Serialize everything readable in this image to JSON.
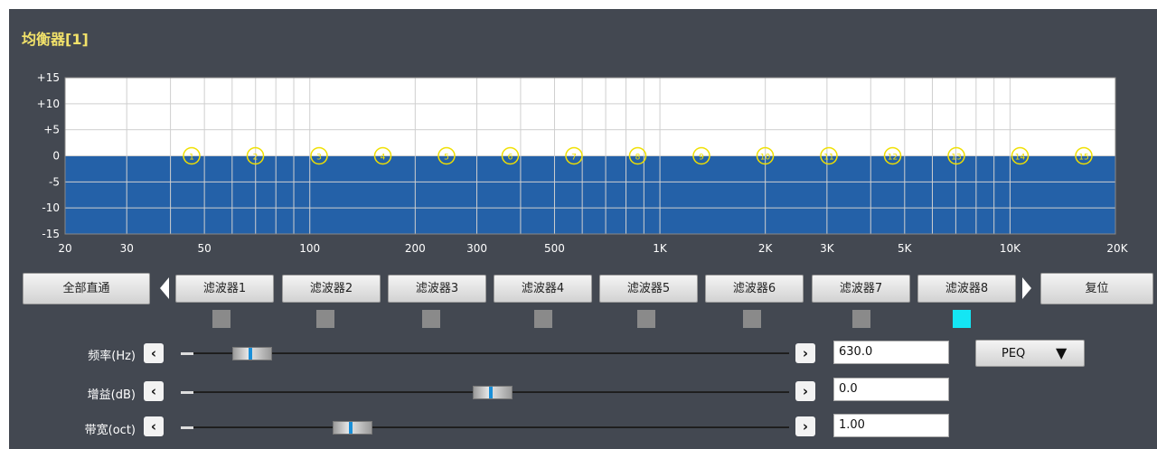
{
  "title": "均衡器[1]",
  "graph": {
    "y_tick_labels": [
      "+15",
      "+10",
      "+5",
      "0",
      "-5",
      "-10",
      "-15"
    ],
    "x_tick_labels": [
      "20",
      "30",
      "50",
      "100",
      "200",
      "300",
      "500",
      "1K",
      "2K",
      "3K",
      "5K",
      "10K",
      "20K"
    ],
    "band_markers": [
      "1",
      "2",
      "3",
      "4",
      "5",
      "6",
      "7",
      "8",
      "9",
      "10",
      "11",
      "12",
      "13",
      "14",
      "15"
    ],
    "fill_color": "#2461a8",
    "background_color": "#ffffff",
    "grid_color": "#cfcfcf"
  },
  "controls": {
    "bypass_all_label": "全部直通",
    "reset_label": "复位",
    "filters": [
      {
        "label": "滤波器1",
        "active": false
      },
      {
        "label": "滤波器2",
        "active": false
      },
      {
        "label": "滤波器3",
        "active": false
      },
      {
        "label": "滤波器4",
        "active": false
      },
      {
        "label": "滤波器5",
        "active": false
      },
      {
        "label": "滤波器6",
        "active": false
      },
      {
        "label": "滤波器7",
        "active": false
      },
      {
        "label": "滤波器8",
        "active": true
      }
    ],
    "active_color": "#14e6f4",
    "inactive_color": "#8a8a8a"
  },
  "params": {
    "frequency": {
      "label": "频率(Hz)",
      "value": "630.0",
      "slider_fraction": 0.07
    },
    "gain": {
      "label": "增益(dB)",
      "value": "0.0",
      "slider_fraction": 0.5
    },
    "bandwidth": {
      "label": "带宽(oct)",
      "value": "1.00",
      "slider_fraction": 0.25
    }
  },
  "filter_type": {
    "label": "PEQ",
    "icon": "caret-down-icon"
  }
}
